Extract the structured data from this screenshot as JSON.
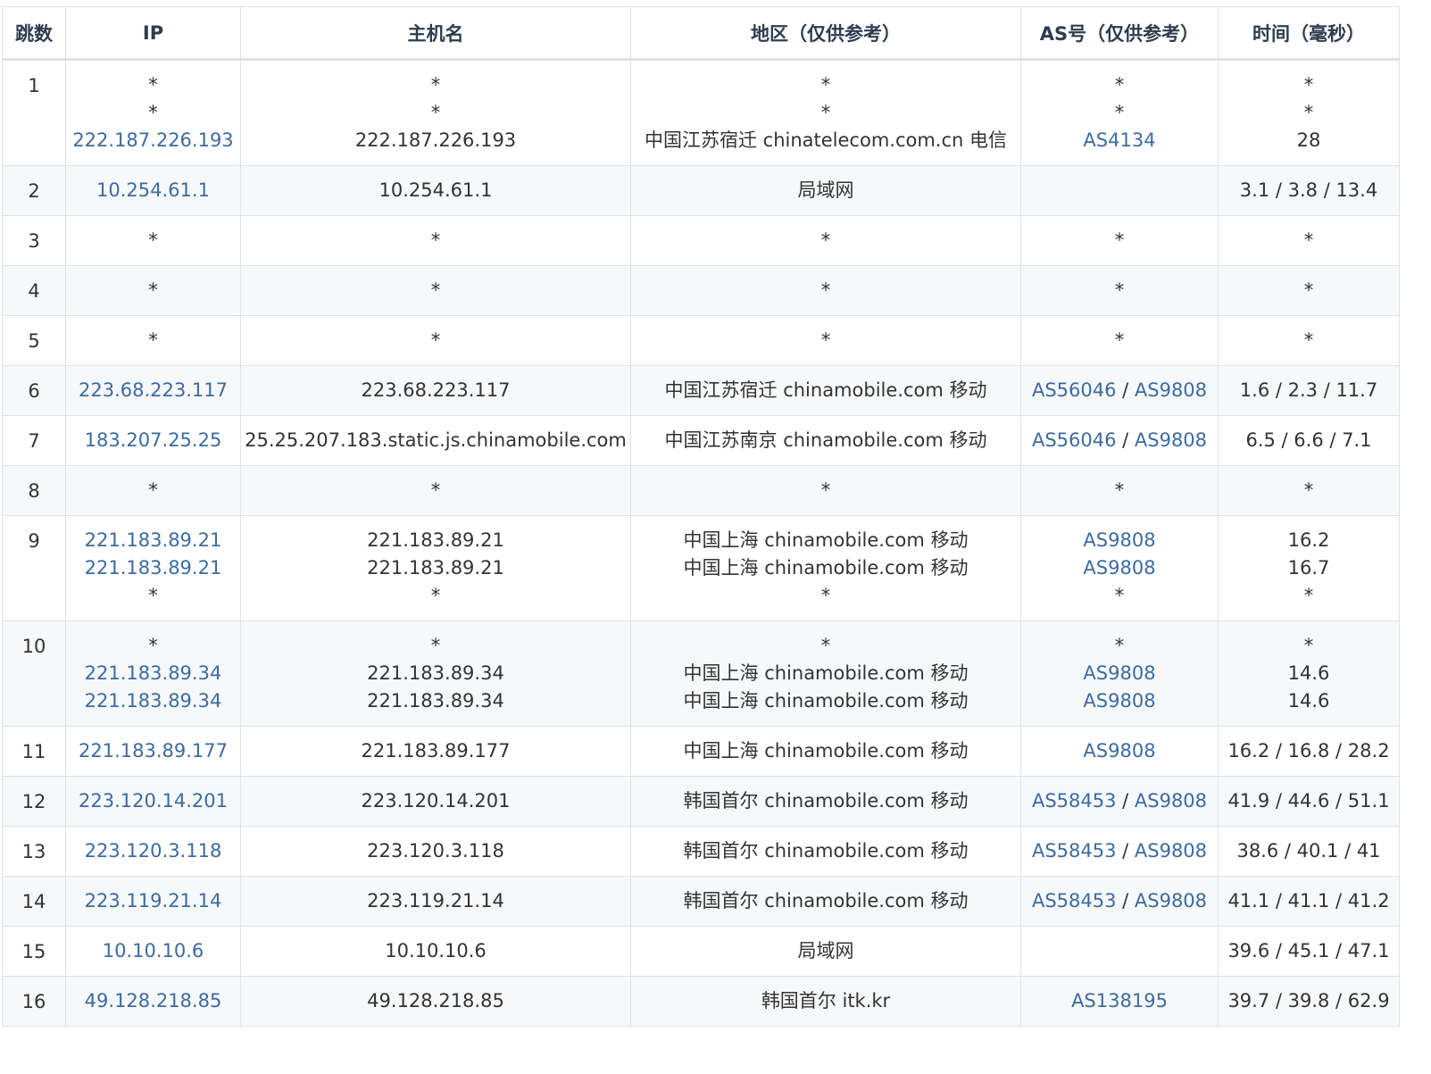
{
  "headers": [
    "跳数",
    "IP",
    "主机名",
    "地区（仅供参考）",
    "AS号（仅供参考）",
    "时间（毫秒）"
  ],
  "rows": [
    {
      "hop": "1",
      "ip": [
        "*",
        "*",
        "222.187.226.193"
      ],
      "host": [
        "*",
        "*",
        "222.187.226.193"
      ],
      "region": [
        "*",
        "*",
        "中国江苏宿迁 chinatelecom.com.cn 电信"
      ],
      "asn": [
        [
          "*"
        ],
        [
          "*"
        ],
        [
          "AS4134"
        ]
      ],
      "time": [
        "*",
        "*",
        "28"
      ]
    },
    {
      "hop": "2",
      "ip": [
        "10.254.61.1"
      ],
      "host": [
        "10.254.61.1"
      ],
      "region": [
        "局域网"
      ],
      "asn": [
        []
      ],
      "time": [
        "3.1 / 3.8 / 13.4"
      ]
    },
    {
      "hop": "3",
      "ip": [
        "*"
      ],
      "host": [
        "*"
      ],
      "region": [
        "*"
      ],
      "asn": [
        [
          "*"
        ]
      ],
      "time": [
        "*"
      ]
    },
    {
      "hop": "4",
      "ip": [
        "*"
      ],
      "host": [
        "*"
      ],
      "region": [
        "*"
      ],
      "asn": [
        [
          "*"
        ]
      ],
      "time": [
        "*"
      ]
    },
    {
      "hop": "5",
      "ip": [
        "*"
      ],
      "host": [
        "*"
      ],
      "region": [
        "*"
      ],
      "asn": [
        [
          "*"
        ]
      ],
      "time": [
        "*"
      ]
    },
    {
      "hop": "6",
      "ip": [
        "223.68.223.117"
      ],
      "host": [
        "223.68.223.117"
      ],
      "region": [
        "中国江苏宿迁 chinamobile.com 移动"
      ],
      "asn": [
        [
          "AS56046",
          "AS9808"
        ]
      ],
      "time": [
        "1.6 / 2.3 / 11.7"
      ]
    },
    {
      "hop": "7",
      "ip": [
        "183.207.25.25"
      ],
      "host": [
        "25.25.207.183.static.js.chinamobile.com"
      ],
      "region": [
        "中国江苏南京 chinamobile.com 移动"
      ],
      "asn": [
        [
          "AS56046",
          "AS9808"
        ]
      ],
      "time": [
        "6.5 / 6.6 / 7.1"
      ]
    },
    {
      "hop": "8",
      "ip": [
        "*"
      ],
      "host": [
        "*"
      ],
      "region": [
        "*"
      ],
      "asn": [
        [
          "*"
        ]
      ],
      "time": [
        "*"
      ]
    },
    {
      "hop": "9",
      "ip": [
        "221.183.89.21",
        "221.183.89.21",
        "*"
      ],
      "host": [
        "221.183.89.21",
        "221.183.89.21",
        "*"
      ],
      "region": [
        "中国上海 chinamobile.com 移动",
        "中国上海 chinamobile.com 移动",
        "*"
      ],
      "asn": [
        [
          "AS9808"
        ],
        [
          "AS9808"
        ],
        [
          "*"
        ]
      ],
      "time": [
        "16.2",
        "16.7",
        "*"
      ]
    },
    {
      "hop": "10",
      "ip": [
        "*",
        "221.183.89.34",
        "221.183.89.34"
      ],
      "host": [
        "*",
        "221.183.89.34",
        "221.183.89.34"
      ],
      "region": [
        "*",
        "中国上海 chinamobile.com 移动",
        "中国上海 chinamobile.com 移动"
      ],
      "asn": [
        [
          "*"
        ],
        [
          "AS9808"
        ],
        [
          "AS9808"
        ]
      ],
      "time": [
        "*",
        "14.6",
        "14.6"
      ]
    },
    {
      "hop": "11",
      "ip": [
        "221.183.89.177"
      ],
      "host": [
        "221.183.89.177"
      ],
      "region": [
        "中国上海 chinamobile.com 移动"
      ],
      "asn": [
        [
          "AS9808"
        ]
      ],
      "time": [
        "16.2 / 16.8 / 28.2"
      ]
    },
    {
      "hop": "12",
      "ip": [
        "223.120.14.201"
      ],
      "host": [
        "223.120.14.201"
      ],
      "region": [
        "韩国首尔 chinamobile.com 移动"
      ],
      "asn": [
        [
          "AS58453",
          "AS9808"
        ]
      ],
      "time": [
        "41.9 / 44.6 / 51.1"
      ]
    },
    {
      "hop": "13",
      "ip": [
        "223.120.3.118"
      ],
      "host": [
        "223.120.3.118"
      ],
      "region": [
        "韩国首尔 chinamobile.com 移动"
      ],
      "asn": [
        [
          "AS58453",
          "AS9808"
        ]
      ],
      "time": [
        "38.6 / 40.1 / 41"
      ]
    },
    {
      "hop": "14",
      "ip": [
        "223.119.21.14"
      ],
      "host": [
        "223.119.21.14"
      ],
      "region": [
        "韩国首尔 chinamobile.com 移动"
      ],
      "asn": [
        [
          "AS58453",
          "AS9808"
        ]
      ],
      "time": [
        "41.1 / 41.1 / 41.2"
      ]
    },
    {
      "hop": "15",
      "ip": [
        "10.10.10.6"
      ],
      "host": [
        "10.10.10.6"
      ],
      "region": [
        "局域网"
      ],
      "asn": [
        []
      ],
      "time": [
        "39.6 / 45.1 / 47.1"
      ]
    },
    {
      "hop": "16",
      "ip": [
        "49.128.218.85"
      ],
      "host": [
        "49.128.218.85"
      ],
      "region": [
        "韩国首尔 itk.kr"
      ],
      "asn": [
        [
          "AS138195"
        ]
      ],
      "time": [
        "39.7 / 39.8 / 62.9"
      ]
    }
  ],
  "asn_separator": " / ",
  "colors": {
    "link": "#3c6ba0",
    "text": "#333333",
    "header": "#2c3e50",
    "stripe": "#f6f8fa",
    "border": "#dfe2e5"
  }
}
